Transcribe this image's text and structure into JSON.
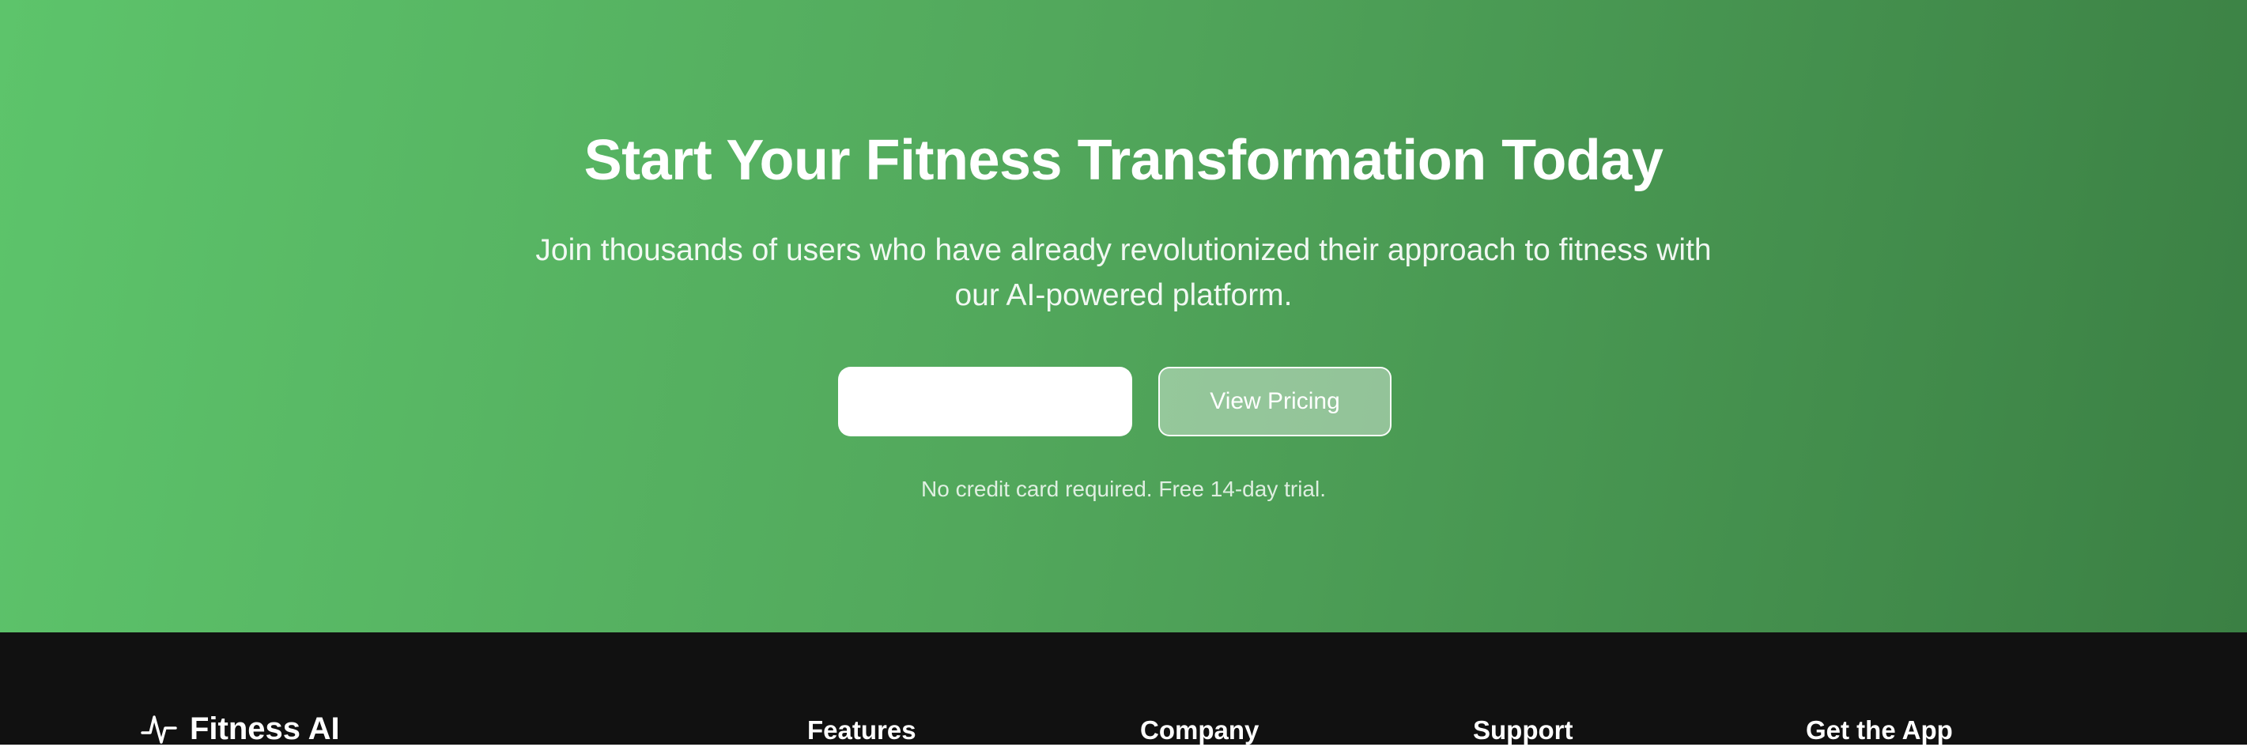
{
  "hero": {
    "title": "Start Your Fitness Transformation Today",
    "subtitle": "Join thousands of users who have already revolutionized their approach to fitness with our AI-powered platform.",
    "email_value": "",
    "pricing_label": "View Pricing",
    "note": "No credit card required. Free 14-day trial.",
    "gradient_start": "#5dc46b",
    "gradient_end": "#3b8044"
  },
  "footer": {
    "brand_name": "Fitness AI",
    "brand_icon": "pulse-icon",
    "headings": [
      "Features",
      "Company",
      "Support",
      "Get the App"
    ],
    "background": "#111111"
  }
}
